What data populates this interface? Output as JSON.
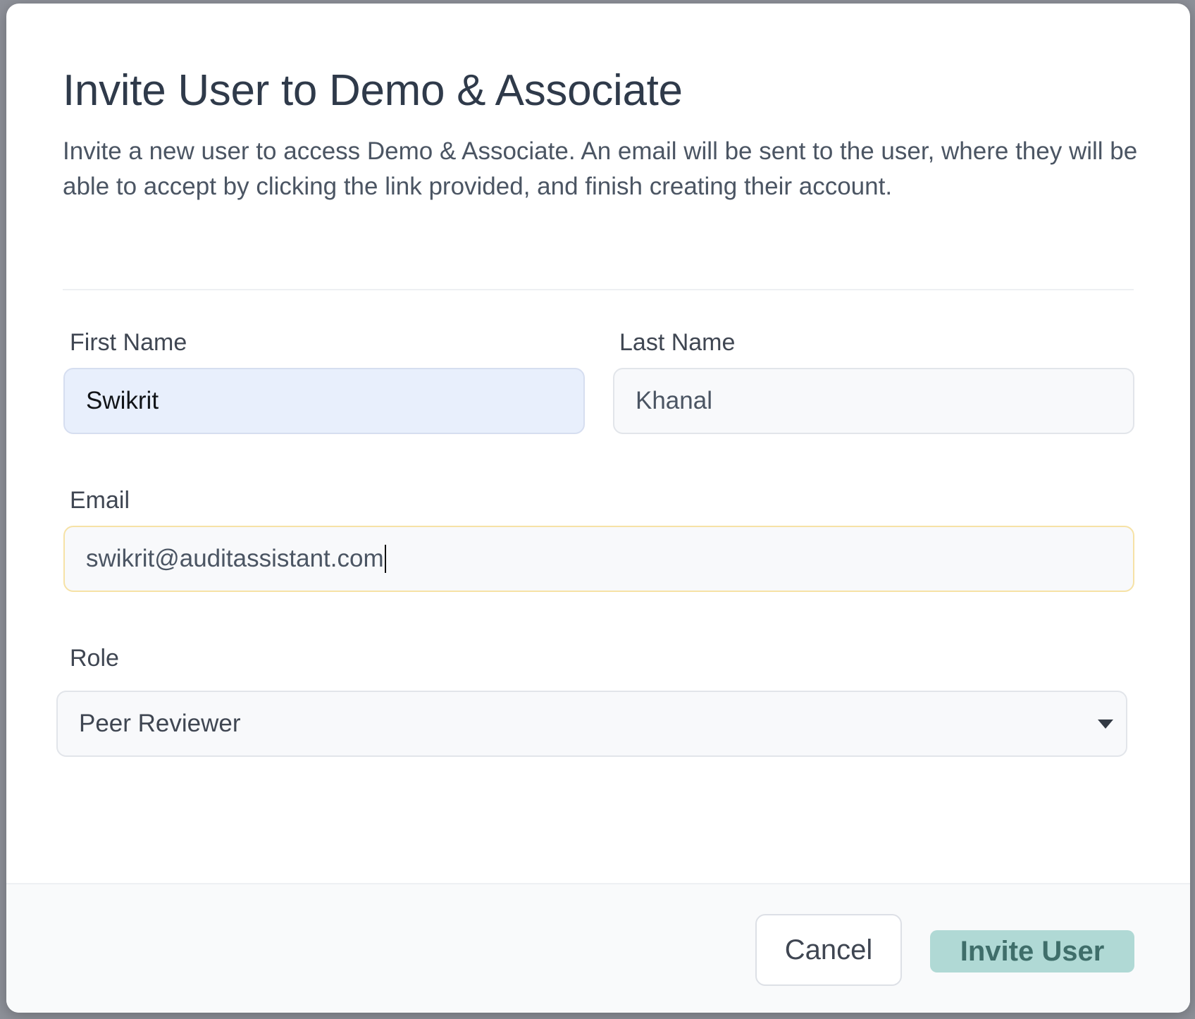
{
  "dialog": {
    "title": "Invite User to Demo & Associate",
    "description": "Invite a new user to access Demo & Associate. An email will be sent to the user, where they will be able to accept by clicking the link provided, and finish creating their account."
  },
  "form": {
    "first_name": {
      "label": "First Name",
      "value": "Swikrit"
    },
    "last_name": {
      "label": "Last Name",
      "value": "Khanal"
    },
    "email": {
      "label": "Email",
      "value": "swikrit@auditassistant.com"
    },
    "role": {
      "label": "Role",
      "selected": "Peer Reviewer",
      "icon": "chevron-down-icon"
    }
  },
  "footer": {
    "cancel_label": "Cancel",
    "invite_label": "Invite User"
  },
  "colors": {
    "primary_button": "#b0d9d5",
    "primary_button_text": "#3f6e6a",
    "autofill_background": "#e8effc",
    "focus_border": "#f6e2a6"
  }
}
